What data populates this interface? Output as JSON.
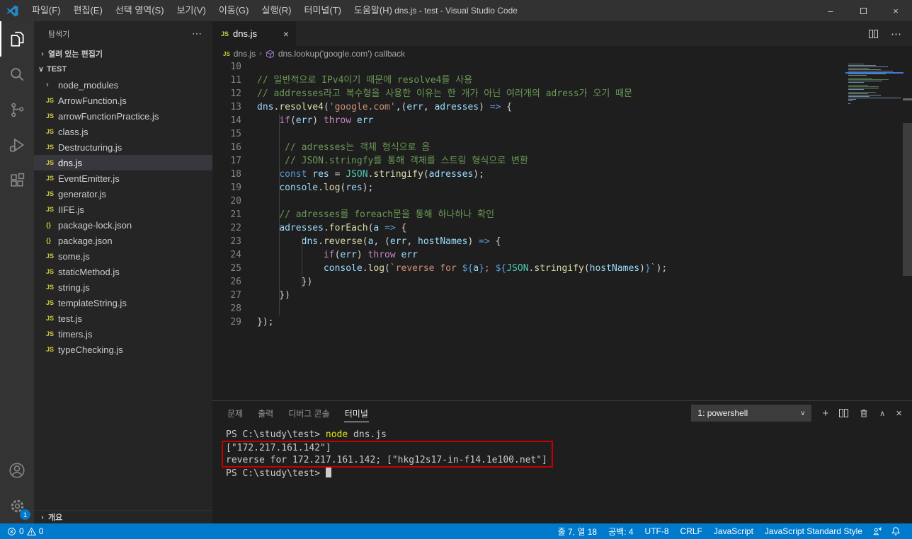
{
  "window": {
    "title": "dns.js - test - Visual Studio Code"
  },
  "menu": [
    "파일(F)",
    "편집(E)",
    "선택 영역(S)",
    "보기(V)",
    "이동(G)",
    "실행(R)",
    "터미널(T)",
    "도움말(H)"
  ],
  "activity_bar": {
    "items": [
      "explorer",
      "search",
      "source-control",
      "run-debug",
      "extensions"
    ],
    "active": "explorer",
    "settings_badge": "1"
  },
  "sidebar": {
    "title": "탐색기",
    "actions": "⋯",
    "sections": {
      "open_editors": "열려 있는 편집기",
      "root": "TEST",
      "outline": "개요"
    },
    "icon_glyphs": {
      "folder": "›",
      "js": "JS",
      "json": "{}"
    },
    "files": [
      {
        "icon": "folder",
        "name": "node_modules"
      },
      {
        "icon": "js",
        "name": "ArrowFunction.js"
      },
      {
        "icon": "js",
        "name": "arrowFunctionPractice.js"
      },
      {
        "icon": "js",
        "name": "class.js"
      },
      {
        "icon": "js",
        "name": "Destructuring.js"
      },
      {
        "icon": "js",
        "name": "dns.js",
        "selected": true
      },
      {
        "icon": "js",
        "name": "EventEmitter.js"
      },
      {
        "icon": "js",
        "name": "generator.js"
      },
      {
        "icon": "js",
        "name": "IIFE.js"
      },
      {
        "icon": "json",
        "name": "package-lock.json"
      },
      {
        "icon": "json",
        "name": "package.json"
      },
      {
        "icon": "js",
        "name": "some.js"
      },
      {
        "icon": "js",
        "name": "staticMethod.js"
      },
      {
        "icon": "js",
        "name": "string.js"
      },
      {
        "icon": "js",
        "name": "templateString.js"
      },
      {
        "icon": "js",
        "name": "test.js"
      },
      {
        "icon": "js",
        "name": "timers.js"
      },
      {
        "icon": "js",
        "name": "typeChecking.js"
      }
    ]
  },
  "editor": {
    "tab": "dns.js",
    "breadcrumb": {
      "file": "dns.js",
      "symbol": "dns.lookup('google.com') callback"
    },
    "minimap": {
      "lines_above": 9,
      "current_line": 7
    },
    "lines": [
      {
        "n": 10,
        "t": []
      },
      {
        "n": 11,
        "t": [
          [
            "com",
            "// 일반적으로 IPv4이기 때문에 resolve4를 사용"
          ]
        ]
      },
      {
        "n": 12,
        "t": [
          [
            "com",
            "// addresses라고 복수형을 사용한 이유는 한 개가 아닌 여러개의 adress가 오기 때문"
          ]
        ]
      },
      {
        "n": 13,
        "t": [
          [
            "var",
            "dns"
          ],
          [
            "pun",
            "."
          ],
          [
            "fn",
            "resolve4"
          ],
          [
            "pun",
            "("
          ],
          [
            "str",
            "'google.com'"
          ],
          [
            "pun",
            ",("
          ],
          [
            "var",
            "err"
          ],
          [
            "pun",
            ", "
          ],
          [
            "var",
            "adresses"
          ],
          [
            "pun",
            ") "
          ],
          [
            "kw",
            "=>"
          ],
          [
            "pun",
            " {"
          ]
        ]
      },
      {
        "n": 14,
        "t": [
          [
            "pun",
            "    "
          ],
          [
            "ctl",
            "if"
          ],
          [
            "pun",
            "("
          ],
          [
            "var",
            "err"
          ],
          [
            "pun",
            ") "
          ],
          [
            "ctl",
            "throw"
          ],
          [
            "pun",
            " "
          ],
          [
            "var",
            "err"
          ]
        ]
      },
      {
        "n": 15,
        "t": []
      },
      {
        "n": 16,
        "t": [
          [
            "pun",
            "     "
          ],
          [
            "com",
            "// adresses는 객체 형식으로 옴"
          ]
        ]
      },
      {
        "n": 17,
        "t": [
          [
            "pun",
            "     "
          ],
          [
            "com",
            "// JSON.stringfy를 통해 객체를 스트링 형식으로 변환"
          ]
        ]
      },
      {
        "n": 18,
        "t": [
          [
            "pun",
            "    "
          ],
          [
            "kw",
            "const"
          ],
          [
            "pun",
            " "
          ],
          [
            "var",
            "res"
          ],
          [
            "pun",
            " = "
          ],
          [
            "cls",
            "JSON"
          ],
          [
            "pun",
            "."
          ],
          [
            "fn",
            "stringify"
          ],
          [
            "pun",
            "("
          ],
          [
            "var",
            "adresses"
          ],
          [
            "pun",
            ");"
          ]
        ]
      },
      {
        "n": 19,
        "t": [
          [
            "pun",
            "    "
          ],
          [
            "var",
            "console"
          ],
          [
            "pun",
            "."
          ],
          [
            "fn",
            "log"
          ],
          [
            "pun",
            "("
          ],
          [
            "var",
            "res"
          ],
          [
            "pun",
            ");"
          ]
        ]
      },
      {
        "n": 20,
        "t": []
      },
      {
        "n": 21,
        "t": [
          [
            "pun",
            "    "
          ],
          [
            "com",
            "// adresses를 foreach문을 통해 하나하나 확인"
          ]
        ]
      },
      {
        "n": 22,
        "t": [
          [
            "pun",
            "    "
          ],
          [
            "var",
            "adresses"
          ],
          [
            "pun",
            "."
          ],
          [
            "fn",
            "forEach"
          ],
          [
            "pun",
            "("
          ],
          [
            "var",
            "a"
          ],
          [
            "pun",
            " "
          ],
          [
            "kw",
            "=>"
          ],
          [
            "pun",
            " {"
          ]
        ]
      },
      {
        "n": 23,
        "t": [
          [
            "pun",
            "        "
          ],
          [
            "var",
            "dns"
          ],
          [
            "pun",
            "."
          ],
          [
            "fn",
            "reverse"
          ],
          [
            "pun",
            "("
          ],
          [
            "var",
            "a"
          ],
          [
            "pun",
            ", ("
          ],
          [
            "var",
            "err"
          ],
          [
            "pun",
            ", "
          ],
          [
            "var",
            "hostNames"
          ],
          [
            "pun",
            ") "
          ],
          [
            "kw",
            "=>"
          ],
          [
            "pun",
            " {"
          ]
        ]
      },
      {
        "n": 24,
        "t": [
          [
            "pun",
            "            "
          ],
          [
            "ctl",
            "if"
          ],
          [
            "pun",
            "("
          ],
          [
            "var",
            "err"
          ],
          [
            "pun",
            ") "
          ],
          [
            "ctl",
            "throw"
          ],
          [
            "pun",
            " "
          ],
          [
            "var",
            "err"
          ]
        ]
      },
      {
        "n": 25,
        "t": [
          [
            "pun",
            "            "
          ],
          [
            "var",
            "console"
          ],
          [
            "pun",
            "."
          ],
          [
            "fn",
            "log"
          ],
          [
            "pun",
            "("
          ],
          [
            "str",
            "`reverse for "
          ],
          [
            "kw",
            "${"
          ],
          [
            "var",
            "a"
          ],
          [
            "kw",
            "}"
          ],
          [
            "str",
            "; "
          ],
          [
            "kw",
            "${"
          ],
          [
            "cls",
            "JSON"
          ],
          [
            "pun",
            "."
          ],
          [
            "fn",
            "stringify"
          ],
          [
            "pun",
            "("
          ],
          [
            "var",
            "hostNames"
          ],
          [
            "pun",
            ")"
          ],
          [
            "kw",
            "}"
          ],
          [
            "str",
            "`"
          ],
          [
            "pun",
            ");"
          ]
        ]
      },
      {
        "n": 26,
        "t": [
          [
            "pun",
            "        })"
          ]
        ]
      },
      {
        "n": 27,
        "t": [
          [
            "pun",
            "    })"
          ]
        ]
      },
      {
        "n": 28,
        "t": []
      },
      {
        "n": 29,
        "t": [
          [
            "pun",
            "});"
          ]
        ]
      }
    ]
  },
  "panel": {
    "tabs": [
      "문제",
      "출력",
      "디버그 콘솔",
      "터미널"
    ],
    "active_tab": "터미널",
    "shell": "1: powershell",
    "terminal": {
      "lines": [
        {
          "boxed": false,
          "tokens": [
            [
              "t",
              "PS C:\\study\\test> "
            ],
            [
              "cmd",
              "node"
            ],
            [
              "t",
              " dns.js"
            ]
          ]
        },
        {
          "boxed": true,
          "tokens": [
            [
              "t",
              "[\"172.217.161.142\"]"
            ]
          ]
        },
        {
          "boxed": true,
          "tokens": [
            [
              "t",
              "reverse for 172.217.161.142; [\"hkg12s17-in-f14.1e100.net\"]"
            ]
          ]
        },
        {
          "boxed": false,
          "tokens": [
            [
              "t",
              "PS C:\\study\\test> "
            ],
            [
              "cursor",
              ""
            ]
          ]
        }
      ]
    }
  },
  "status_bar": {
    "errors": "0",
    "warnings": "0",
    "right": [
      "줄 7, 열 18",
      "공백: 4",
      "UTF-8",
      "CRLF",
      "JavaScript",
      "JavaScript Standard Style"
    ]
  },
  "colors": {
    "accent": "#007ACC",
    "statusbar_bg": "#007ACC",
    "titlebar_bg": "#323233",
    "sidebar_bg": "#252526",
    "editor_bg": "#1E1E1E",
    "selection_bg": "#37373D",
    "annotation_red": "#C50000",
    "tokens": {
      "com": "#6A9955",
      "var": "#9CDCFE",
      "fn": "#DCDCAA",
      "str": "#CE9178",
      "kw": "#569CD6",
      "ctl": "#C586C0",
      "cls": "#4EC9B0",
      "pun": "#D4D4D4",
      "cmd": "#E5E510"
    }
  }
}
